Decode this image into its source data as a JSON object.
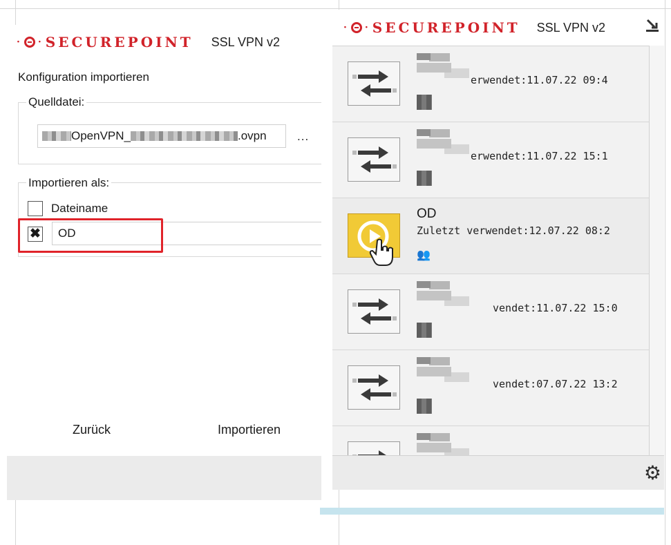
{
  "left": {
    "brand": "SECUREPOINT",
    "product": "SSL VPN v2",
    "section_title": "Konfiguration importieren",
    "source": {
      "legend": "Quelldatei:",
      "file_prefix": "OpenVPN_",
      "file_suffix": ".ovpn",
      "browse_label": "..."
    },
    "import_as": {
      "legend": "Importieren als:",
      "filename_label": "Dateiname",
      "filename_checked": false,
      "custom_checked_mark": "✖",
      "custom_value": "OD"
    },
    "back_label": "Zurück",
    "import_label": "Importieren"
  },
  "right": {
    "brand": "SECUREPOINT",
    "product": "SSL VPN v2",
    "connections": [
      {
        "name": "",
        "last_used": "erwendet:11.07.22 09:4",
        "active": false
      },
      {
        "name": "",
        "last_used": "erwendet:11.07.22 15:1",
        "active": false
      },
      {
        "name": "OD",
        "last_used": "Zuletzt verwendet:12.07.22 08:2",
        "active": true
      },
      {
        "name": "",
        "last_used": "vendet:11.07.22 15:0",
        "active": false
      },
      {
        "name": "",
        "last_used": "vendet:07.07.22 13:2",
        "active": false
      },
      {
        "name": "",
        "last_used": "",
        "active": false
      }
    ]
  },
  "colors": {
    "brand_red": "#d1232a",
    "active_yellow": "#f1ca36",
    "highlight_red": "#e0232a",
    "panel_gray": "#ebebeb"
  },
  "icons": [
    "swap-arrows-icon",
    "play-icon",
    "hand-cursor-icon",
    "people-icon",
    "gear-icon",
    "pin-icon"
  ]
}
